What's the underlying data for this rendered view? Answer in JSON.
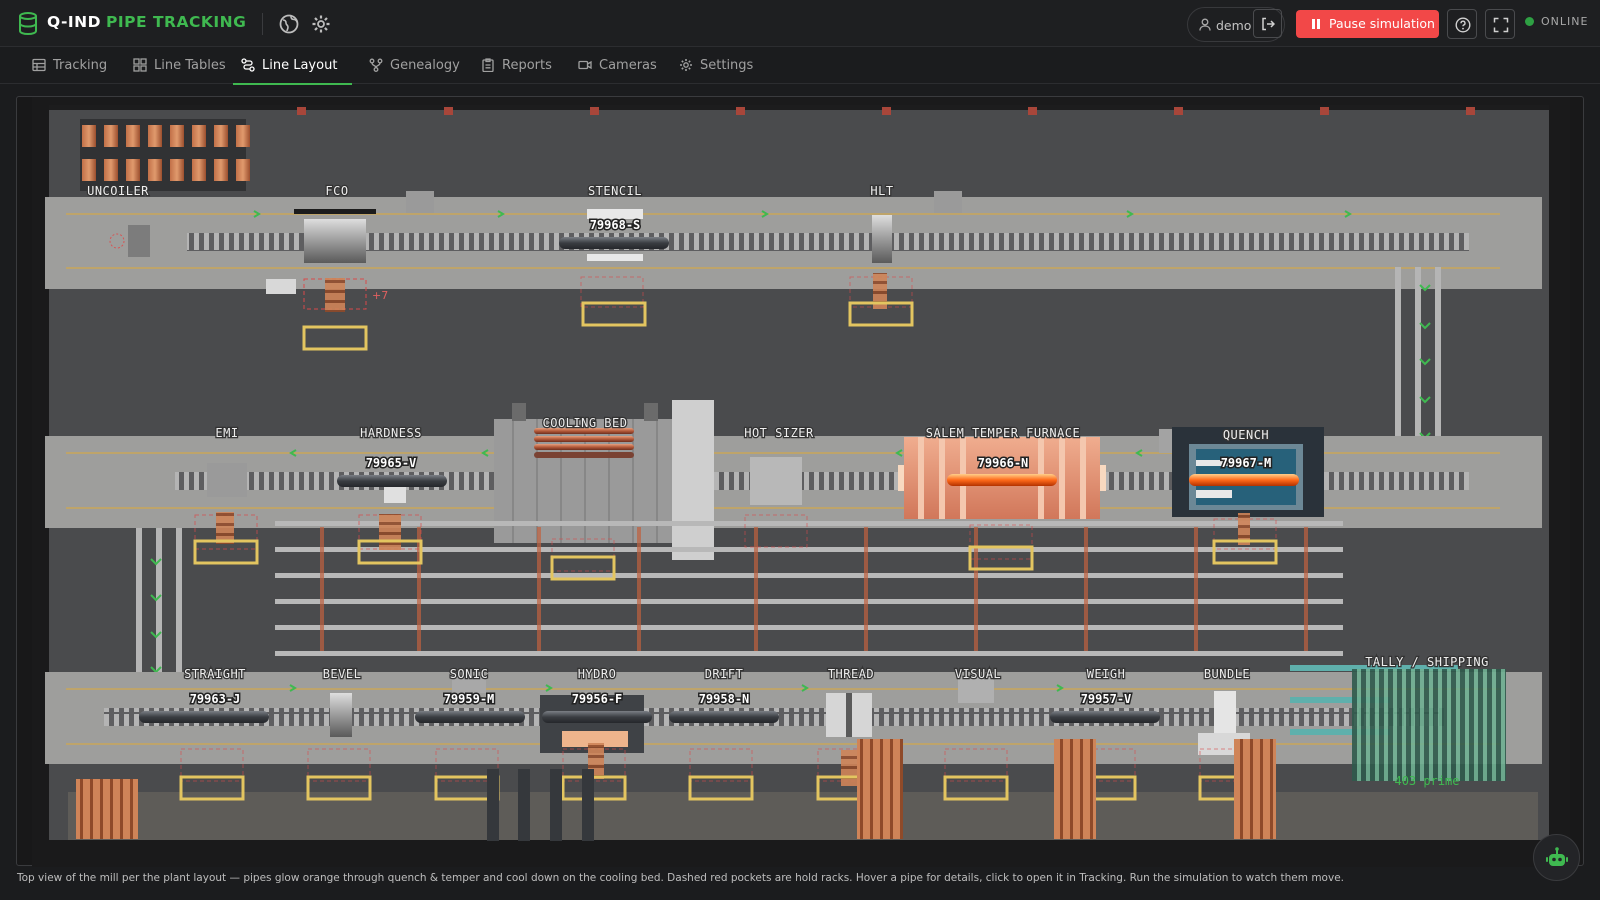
{
  "header": {
    "brand_primary": "Q-IND",
    "brand_accent": "PIPE TRACKING",
    "user": "demo",
    "pause_label": "Pause simulation",
    "status": "ONLINE",
    "colors": {
      "accent": "#3fb950",
      "pause": "#f24848"
    },
    "icons": [
      "database-icon",
      "globe-icon",
      "gear-icon",
      "user-icon",
      "logout-icon",
      "help-icon",
      "fullscreen-icon"
    ]
  },
  "tabs": [
    {
      "label": "Tracking",
      "icon": "table-icon"
    },
    {
      "label": "Line Tables",
      "icon": "grid-icon"
    },
    {
      "label": "Line Layout",
      "icon": "route-icon",
      "active": true
    },
    {
      "label": "Genealogy",
      "icon": "branch-icon"
    },
    {
      "label": "Reports",
      "icon": "clipboard-icon"
    },
    {
      "label": "Cameras",
      "icon": "camera-icon"
    },
    {
      "label": "Settings",
      "icon": "gear-icon"
    }
  ],
  "layout": {
    "row1": {
      "stations": [
        "UNCOILER",
        "FCO",
        "STENCIL",
        "HLT"
      ],
      "pipes": [
        {
          "station": "STENCIL",
          "tag": "79968-S"
        }
      ],
      "hold_count": "+7"
    },
    "row2": {
      "stations": [
        "EMI",
        "HARDNESS",
        "COOLING BED",
        "HOT SIZER",
        "SALEM TEMPER FURNACE",
        "QUENCH"
      ],
      "pipes": [
        {
          "station": "HARDNESS",
          "tag": "79965-V"
        },
        {
          "station": "SALEM TEMPER FURNACE",
          "tag": "79966-N"
        },
        {
          "station": "QUENCH",
          "tag": "79967-M"
        }
      ]
    },
    "row3": {
      "stations": [
        "STRAIGHT",
        "BEVEL",
        "SONIC",
        "HYDRO",
        "DRIFT",
        "THREAD",
        "VISUAL",
        "WEIGH",
        "BUNDLE"
      ],
      "pipes": [
        {
          "station": "STRAIGHT",
          "tag": "79963-J"
        },
        {
          "station": "SONIC",
          "tag": "79959-M"
        },
        {
          "station": "HYDRO",
          "tag": "79956-F"
        },
        {
          "station": "DRIFT",
          "tag": "79958-N"
        },
        {
          "station": "WEIGH",
          "tag": "79957-V"
        }
      ]
    },
    "tally": {
      "title": "TALLY / SHIPPING",
      "count": "403 prime"
    }
  },
  "caption": "Top view of the mill per the plant layout — pipes glow orange through quench & temper and cool down on the cooling bed. Dashed red pockets are hold racks. Hover a pipe for details, click to open it in Tracking. Run the simulation to watch them move."
}
